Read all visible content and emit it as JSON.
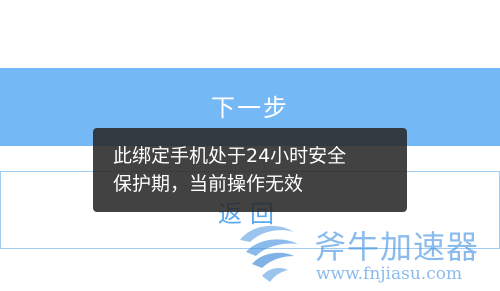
{
  "buttons": {
    "next_label": "下一步",
    "back_label": "返回"
  },
  "toast": {
    "line1": "此绑定手机处于24小时安全",
    "line2": "保护期，当前操作无效"
  },
  "watermark": {
    "name": "斧牛加速器",
    "url": "www.fnjiasu.com"
  },
  "colors": {
    "primary": "#74b8f5",
    "outline": "#9fcdf3",
    "toast_bg": "#282828",
    "watermark": "#3e8ee0"
  }
}
